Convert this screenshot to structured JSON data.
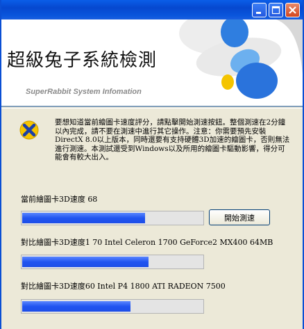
{
  "window": {
    "header_title": "超級兔子系統檢測",
    "header_subtitle": "SuperRabbit System Infomation"
  },
  "notice": {
    "text": "要想知道當前繪圖卡速度評分，請點擊開始測速按鈕。整個測速在2分鐘以內完成，請不要在測速中進行其它操作。注意：你需要預先安裝DirectX 8.0以上版本，同時還要有支持硬體3D加速的繪圖卡，否則無法進行測速。本測試還受到Windows以及所用的繪圖卡驅動影響，得分可能會有較大出入。"
  },
  "current": {
    "label": "當前繪圖卡3D速度   68",
    "level_percent": 68
  },
  "start_button": {
    "label": "開始測速"
  },
  "comparisons": [
    {
      "label": "對比繪圖卡3D速度1 70   Intel Celeron 1700  GeForce2 MX400 64MB",
      "level_percent": 70
    },
    {
      "label": "對比繪圖卡3D速度60   Intel P4 1800   ATI RADEON 7500",
      "level_percent": 60
    }
  ],
  "colors": {
    "progress_fill": "#2154f0",
    "titlebar": "#0a56dc",
    "close_button": "#d2461f"
  },
  "icons": [
    "minimize-icon",
    "maximize-icon",
    "close-icon",
    "rabbit-logo",
    "warning-x-icon"
  ]
}
